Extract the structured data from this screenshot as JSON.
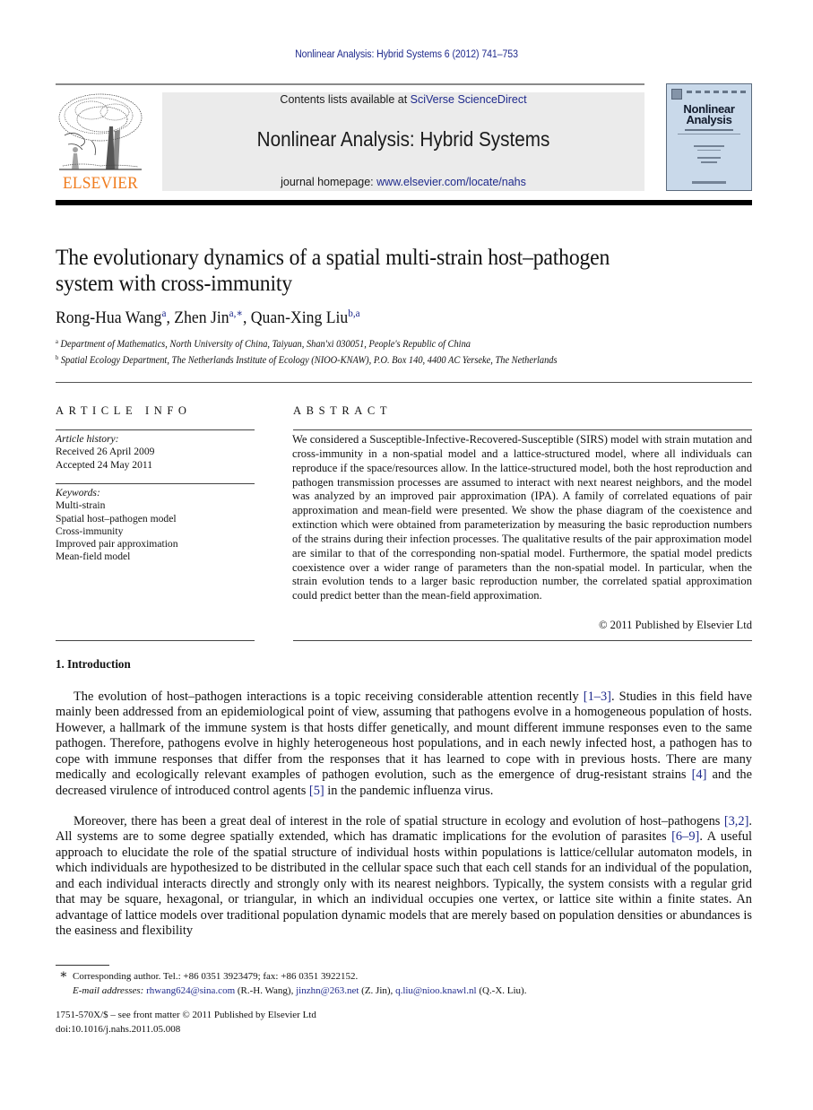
{
  "running_head": "Nonlinear Analysis: Hybrid Systems 6 (2012) 741–753",
  "masthead": {
    "publisher_wordmark": "ELSEVIER",
    "contents_prefix": "Contents lists available at ",
    "contents_link": "SciVerse ScienceDirect",
    "journal_name": "Nonlinear Analysis: Hybrid Systems",
    "homepage_prefix": "journal homepage: ",
    "homepage_link": "www.elsevier.com/locate/nahs",
    "cover_title_line1": "Nonlinear",
    "cover_title_line2": "Analysis"
  },
  "article": {
    "title_line1": "The evolutionary dynamics of a spatial multi-strain host–pathogen",
    "title_line2": "system with cross-immunity",
    "authors": [
      {
        "name": "Rong-Hua Wang",
        "marks": "a",
        "sep": ", "
      },
      {
        "name": "Zhen Jin",
        "marks": "a,∗",
        "sep": ", "
      },
      {
        "name": "Quan-Xing Liu",
        "marks": "b,a",
        "sep": ""
      }
    ],
    "affiliations": [
      {
        "mark": "a",
        "text": "Department of Mathematics, North University of China, Taiyuan, Shan'xi 030051, People's Republic of China"
      },
      {
        "mark": "b",
        "text": "Spatial Ecology Department, The Netherlands Institute of Ecology (NIOO-KNAW), P.O. Box 140, 4400 AC Yerseke, The Netherlands"
      }
    ]
  },
  "article_info": {
    "heading": "ARTICLE INFO",
    "history_label": "Article history:",
    "received": "Received 26 April 2009",
    "accepted": "Accepted 24 May 2011",
    "keywords_label": "Keywords:",
    "keywords": [
      "Multi-strain",
      "Spatial host–pathogen model",
      "Cross-immunity",
      "Improved pair approximation",
      "Mean-field model"
    ]
  },
  "abstract": {
    "heading": "ABSTRACT",
    "text": "We considered a Susceptible-Infective-Recovered-Susceptible (SIRS) model with strain mutation and cross-immunity in a non-spatial model and a lattice-structured model, where all individuals can reproduce if the space/resources allow. In the lattice-structured model, both the host reproduction and pathogen transmission processes are assumed to interact with next nearest neighbors, and the model was analyzed by an improved pair approximation (IPA). A family of correlated equations of pair approximation and mean-field were presented. We show the phase diagram of the coexistence and extinction which were obtained from parameterization by measuring the basic reproduction numbers of the strains during their infection processes. The qualitative results of the pair approximation model are similar to that of the corresponding non-spatial model. Furthermore, the spatial model predicts coexistence over a wider range of parameters than the non-spatial model. In particular, when the strain evolution tends to a larger basic reproduction number, the correlated spatial approximation could predict better than the mean-field approximation.",
    "copyright": "© 2011 Published by Elsevier Ltd"
  },
  "introduction": {
    "heading": "1.  Introduction",
    "para1": [
      {
        "t": "The evolution of host–pathogen interactions is a topic receiving considerable attention recently "
      },
      {
        "ref": "[1–3]"
      },
      {
        "t": ". Studies in this field have mainly been addressed from an epidemiological point of view, assuming that pathogens evolve in a homogeneous population of hosts. However, a hallmark of the immune system is that hosts differ genetically, and mount different immune responses even to the same pathogen. Therefore, pathogens evolve in highly heterogeneous host populations, and in each newly infected host, a pathogen has to cope with immune responses that differ from the responses that it has learned to cope with in previous hosts. There are many medically and ecologically relevant examples of pathogen evolution, such as the emergence of drug-resistant strains "
      },
      {
        "ref": "[4]"
      },
      {
        "t": " and the decreased virulence of introduced control agents "
      },
      {
        "ref": "[5]"
      },
      {
        "t": " in the pandemic influenza virus."
      }
    ],
    "para2": [
      {
        "t": "Moreover, there has been a great deal of interest in the role of spatial structure in ecology and evolution of host–pathogens "
      },
      {
        "ref": "[3,2]"
      },
      {
        "t": ". All systems are to some degree spatially extended, which has dramatic implications for the evolution of parasites "
      },
      {
        "ref": "[6–9]"
      },
      {
        "t": ". A useful approach to elucidate the role of the spatial structure of individual hosts within populations is lattice/cellular automaton models, in which individuals are hypothesized to be distributed in the cellular space such that each cell stands for an individual of the population, and each individual interacts directly and strongly only with its nearest neighbors. Typically, the system consists with a regular grid that may be square, hexagonal, or triangular, in which an individual occupies one vertex, or lattice site within a finite states. An advantage of lattice models over traditional population dynamic models that are merely based on population densities or abundances is the easiness and flexibility"
      }
    ]
  },
  "footnotes": {
    "star": "∗",
    "corresponding": "Corresponding author. Tel.: +86 0351 3923479; fax: +86 0351 3922152.",
    "email_label": "E-mail addresses:",
    "emails": [
      {
        "addr": "rhwang624@sina.com",
        "who": " (R.-H. Wang), "
      },
      {
        "addr": "jinzhn@263.net",
        "who": " (Z. Jin), "
      },
      {
        "addr": "q.liu@nioo.knawl.nl",
        "who": " (Q.-X. Liu)."
      }
    ],
    "issn": "1751-570X/$ – see front matter © 2011 Published by Elsevier Ltd",
    "doi": "doi:10.1016/j.nahs.2011.05.008"
  },
  "colors": {
    "link": "#1f2a8c",
    "elsevier_orange": "#f07c1e",
    "masthead_gray": "#ebebeb",
    "cover_blue": "#c9d9ea"
  }
}
